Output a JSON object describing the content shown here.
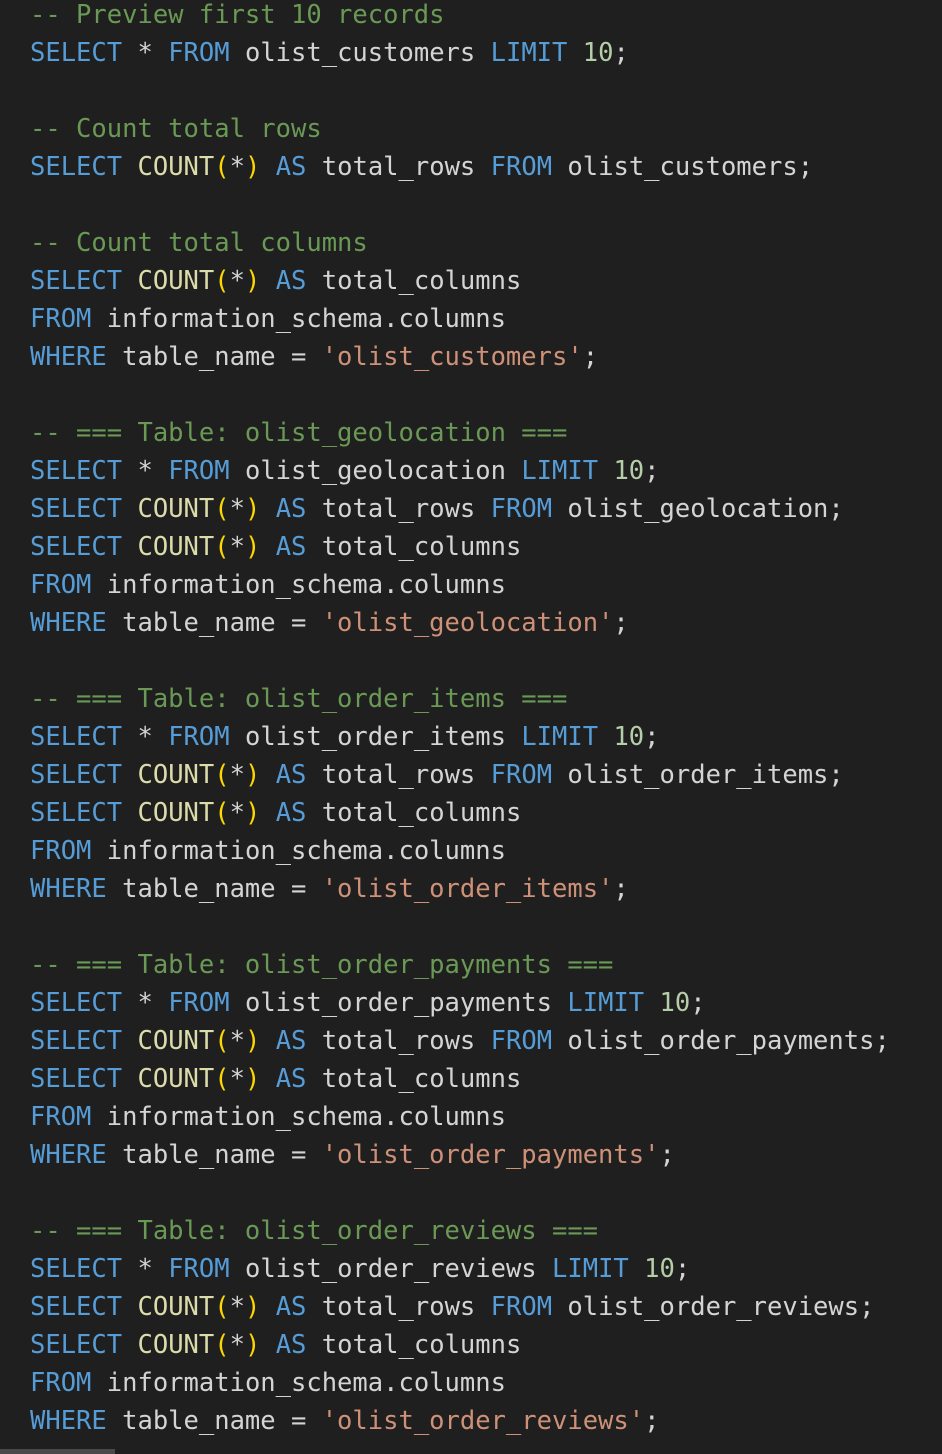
{
  "editor": {
    "language": "sql",
    "theme_colors": {
      "background": "#1f1f1f",
      "keyword": "#569cd6",
      "function": "#dcdcaa",
      "comment": "#6a9955",
      "string": "#ce9178",
      "number": "#b5cea8",
      "identifier": "#d4d4d4",
      "paren": "#ffd700"
    },
    "lines": [
      [
        {
          "t": "com",
          "v": "-- Preview first 10 records"
        }
      ],
      [
        {
          "t": "kw",
          "v": "SELECT"
        },
        {
          "t": "op",
          "v": " * "
        },
        {
          "t": "kw",
          "v": "FROM"
        },
        {
          "t": "id",
          "v": " olist_customers "
        },
        {
          "t": "kw",
          "v": "LIMIT"
        },
        {
          "t": "op",
          "v": " "
        },
        {
          "t": "num",
          "v": "10"
        },
        {
          "t": "op",
          "v": ";"
        }
      ],
      [],
      [
        {
          "t": "com",
          "v": "-- Count total rows"
        }
      ],
      [
        {
          "t": "kw",
          "v": "SELECT"
        },
        {
          "t": "op",
          "v": " "
        },
        {
          "t": "fn",
          "v": "COUNT"
        },
        {
          "t": "paren",
          "v": "("
        },
        {
          "t": "op",
          "v": "*"
        },
        {
          "t": "paren",
          "v": ")"
        },
        {
          "t": "op",
          "v": " "
        },
        {
          "t": "kw",
          "v": "AS"
        },
        {
          "t": "id",
          "v": " total_rows "
        },
        {
          "t": "kw",
          "v": "FROM"
        },
        {
          "t": "id",
          "v": " olist_customers;"
        }
      ],
      [],
      [
        {
          "t": "com",
          "v": "-- Count total columns"
        }
      ],
      [
        {
          "t": "kw",
          "v": "SELECT"
        },
        {
          "t": "op",
          "v": " "
        },
        {
          "t": "fn",
          "v": "COUNT"
        },
        {
          "t": "paren",
          "v": "("
        },
        {
          "t": "op",
          "v": "*"
        },
        {
          "t": "paren",
          "v": ")"
        },
        {
          "t": "op",
          "v": " "
        },
        {
          "t": "kw",
          "v": "AS"
        },
        {
          "t": "id",
          "v": " total_columns"
        }
      ],
      [
        {
          "t": "kw",
          "v": "FROM"
        },
        {
          "t": "id",
          "v": " information_schema.columns"
        }
      ],
      [
        {
          "t": "kw",
          "v": "WHERE"
        },
        {
          "t": "id",
          "v": " table_name = "
        },
        {
          "t": "str",
          "v": "'olist_customers'"
        },
        {
          "t": "op",
          "v": ";"
        }
      ],
      [],
      [
        {
          "t": "com",
          "v": "-- === Table: olist_geolocation ==="
        }
      ],
      [
        {
          "t": "kw",
          "v": "SELECT"
        },
        {
          "t": "op",
          "v": " * "
        },
        {
          "t": "kw",
          "v": "FROM"
        },
        {
          "t": "id",
          "v": " olist_geolocation "
        },
        {
          "t": "kw",
          "v": "LIMIT"
        },
        {
          "t": "op",
          "v": " "
        },
        {
          "t": "num",
          "v": "10"
        },
        {
          "t": "op",
          "v": ";"
        }
      ],
      [
        {
          "t": "kw",
          "v": "SELECT"
        },
        {
          "t": "op",
          "v": " "
        },
        {
          "t": "fn",
          "v": "COUNT"
        },
        {
          "t": "paren",
          "v": "("
        },
        {
          "t": "op",
          "v": "*"
        },
        {
          "t": "paren",
          "v": ")"
        },
        {
          "t": "op",
          "v": " "
        },
        {
          "t": "kw",
          "v": "AS"
        },
        {
          "t": "id",
          "v": " total_rows "
        },
        {
          "t": "kw",
          "v": "FROM"
        },
        {
          "t": "id",
          "v": " olist_geolocation;"
        }
      ],
      [
        {
          "t": "kw",
          "v": "SELECT"
        },
        {
          "t": "op",
          "v": " "
        },
        {
          "t": "fn",
          "v": "COUNT"
        },
        {
          "t": "paren",
          "v": "("
        },
        {
          "t": "op",
          "v": "*"
        },
        {
          "t": "paren",
          "v": ")"
        },
        {
          "t": "op",
          "v": " "
        },
        {
          "t": "kw",
          "v": "AS"
        },
        {
          "t": "id",
          "v": " total_columns"
        }
      ],
      [
        {
          "t": "kw",
          "v": "FROM"
        },
        {
          "t": "id",
          "v": " information_schema.columns"
        }
      ],
      [
        {
          "t": "kw",
          "v": "WHERE"
        },
        {
          "t": "id",
          "v": " table_name = "
        },
        {
          "t": "str",
          "v": "'olist_geolocation'"
        },
        {
          "t": "op",
          "v": ";"
        }
      ],
      [],
      [
        {
          "t": "com",
          "v": "-- === Table: olist_order_items ==="
        }
      ],
      [
        {
          "t": "kw",
          "v": "SELECT"
        },
        {
          "t": "op",
          "v": " * "
        },
        {
          "t": "kw",
          "v": "FROM"
        },
        {
          "t": "id",
          "v": " olist_order_items "
        },
        {
          "t": "kw",
          "v": "LIMIT"
        },
        {
          "t": "op",
          "v": " "
        },
        {
          "t": "num",
          "v": "10"
        },
        {
          "t": "op",
          "v": ";"
        }
      ],
      [
        {
          "t": "kw",
          "v": "SELECT"
        },
        {
          "t": "op",
          "v": " "
        },
        {
          "t": "fn",
          "v": "COUNT"
        },
        {
          "t": "paren",
          "v": "("
        },
        {
          "t": "op",
          "v": "*"
        },
        {
          "t": "paren",
          "v": ")"
        },
        {
          "t": "op",
          "v": " "
        },
        {
          "t": "kw",
          "v": "AS"
        },
        {
          "t": "id",
          "v": " total_rows "
        },
        {
          "t": "kw",
          "v": "FROM"
        },
        {
          "t": "id",
          "v": " olist_order_items;"
        }
      ],
      [
        {
          "t": "kw",
          "v": "SELECT"
        },
        {
          "t": "op",
          "v": " "
        },
        {
          "t": "fn",
          "v": "COUNT"
        },
        {
          "t": "paren",
          "v": "("
        },
        {
          "t": "op",
          "v": "*"
        },
        {
          "t": "paren",
          "v": ")"
        },
        {
          "t": "op",
          "v": " "
        },
        {
          "t": "kw",
          "v": "AS"
        },
        {
          "t": "id",
          "v": " total_columns"
        }
      ],
      [
        {
          "t": "kw",
          "v": "FROM"
        },
        {
          "t": "id",
          "v": " information_schema.columns"
        }
      ],
      [
        {
          "t": "kw",
          "v": "WHERE"
        },
        {
          "t": "id",
          "v": " table_name = "
        },
        {
          "t": "str",
          "v": "'olist_order_items'"
        },
        {
          "t": "op",
          "v": ";"
        }
      ],
      [],
      [
        {
          "t": "com",
          "v": "-- === Table: olist_order_payments ==="
        }
      ],
      [
        {
          "t": "kw",
          "v": "SELECT"
        },
        {
          "t": "op",
          "v": " * "
        },
        {
          "t": "kw",
          "v": "FROM"
        },
        {
          "t": "id",
          "v": " olist_order_payments "
        },
        {
          "t": "kw",
          "v": "LIMIT"
        },
        {
          "t": "op",
          "v": " "
        },
        {
          "t": "num",
          "v": "10"
        },
        {
          "t": "op",
          "v": ";"
        }
      ],
      [
        {
          "t": "kw",
          "v": "SELECT"
        },
        {
          "t": "op",
          "v": " "
        },
        {
          "t": "fn",
          "v": "COUNT"
        },
        {
          "t": "paren",
          "v": "("
        },
        {
          "t": "op",
          "v": "*"
        },
        {
          "t": "paren",
          "v": ")"
        },
        {
          "t": "op",
          "v": " "
        },
        {
          "t": "kw",
          "v": "AS"
        },
        {
          "t": "id",
          "v": " total_rows "
        },
        {
          "t": "kw",
          "v": "FROM"
        },
        {
          "t": "id",
          "v": " olist_order_payments;"
        }
      ],
      [
        {
          "t": "kw",
          "v": "SELECT"
        },
        {
          "t": "op",
          "v": " "
        },
        {
          "t": "fn",
          "v": "COUNT"
        },
        {
          "t": "paren",
          "v": "("
        },
        {
          "t": "op",
          "v": "*"
        },
        {
          "t": "paren",
          "v": ")"
        },
        {
          "t": "op",
          "v": " "
        },
        {
          "t": "kw",
          "v": "AS"
        },
        {
          "t": "id",
          "v": " total_columns"
        }
      ],
      [
        {
          "t": "kw",
          "v": "FROM"
        },
        {
          "t": "id",
          "v": " information_schema.columns"
        }
      ],
      [
        {
          "t": "kw",
          "v": "WHERE"
        },
        {
          "t": "id",
          "v": " table_name = "
        },
        {
          "t": "str",
          "v": "'olist_order_payments'"
        },
        {
          "t": "op",
          "v": ";"
        }
      ],
      [],
      [
        {
          "t": "com",
          "v": "-- === Table: olist_order_reviews ==="
        }
      ],
      [
        {
          "t": "kw",
          "v": "SELECT"
        },
        {
          "t": "op",
          "v": " * "
        },
        {
          "t": "kw",
          "v": "FROM"
        },
        {
          "t": "id",
          "v": " olist_order_reviews "
        },
        {
          "t": "kw",
          "v": "LIMIT"
        },
        {
          "t": "op",
          "v": " "
        },
        {
          "t": "num",
          "v": "10"
        },
        {
          "t": "op",
          "v": ";"
        }
      ],
      [
        {
          "t": "kw",
          "v": "SELECT"
        },
        {
          "t": "op",
          "v": " "
        },
        {
          "t": "fn",
          "v": "COUNT"
        },
        {
          "t": "paren",
          "v": "("
        },
        {
          "t": "op",
          "v": "*"
        },
        {
          "t": "paren",
          "v": ")"
        },
        {
          "t": "op",
          "v": " "
        },
        {
          "t": "kw",
          "v": "AS"
        },
        {
          "t": "id",
          "v": " total_rows "
        },
        {
          "t": "kw",
          "v": "FROM"
        },
        {
          "t": "id",
          "v": " olist_order_reviews;"
        }
      ],
      [
        {
          "t": "kw",
          "v": "SELECT"
        },
        {
          "t": "op",
          "v": " "
        },
        {
          "t": "fn",
          "v": "COUNT"
        },
        {
          "t": "paren",
          "v": "("
        },
        {
          "t": "op",
          "v": "*"
        },
        {
          "t": "paren",
          "v": ")"
        },
        {
          "t": "op",
          "v": " "
        },
        {
          "t": "kw",
          "v": "AS"
        },
        {
          "t": "id",
          "v": " total_columns"
        }
      ],
      [
        {
          "t": "kw",
          "v": "FROM"
        },
        {
          "t": "id",
          "v": " information_schema.columns"
        }
      ],
      [
        {
          "t": "kw",
          "v": "WHERE"
        },
        {
          "t": "id",
          "v": " table_name = "
        },
        {
          "t": "str",
          "v": "'olist_order_reviews'"
        },
        {
          "t": "op",
          "v": ";"
        }
      ]
    ]
  }
}
